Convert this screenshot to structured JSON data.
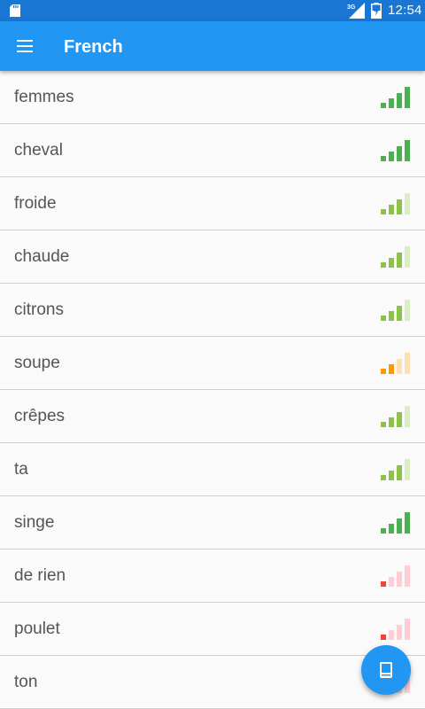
{
  "status_bar": {
    "network": "3G",
    "time": "12:54",
    "icons": [
      "sd-card-icon",
      "signal-icon",
      "battery-charging-icon"
    ]
  },
  "app_bar": {
    "title": "French",
    "menu_icon": "hamburger-menu-icon"
  },
  "colors": {
    "status_bar": "#1976d2",
    "app_bar": "#2196f3",
    "strong": "#4caf50",
    "medium": "#8bc34a",
    "weak": "#ff9800",
    "poor": "#f44336"
  },
  "words": [
    {
      "text": "femmes",
      "level": 4,
      "color": "#4caf50",
      "faded": "#c8e6c9"
    },
    {
      "text": "cheval",
      "level": 4,
      "color": "#4caf50",
      "faded": "#c8e6c9"
    },
    {
      "text": "froide",
      "level": 3,
      "color": "#8bc34a",
      "faded": "#dcedc8"
    },
    {
      "text": "chaude",
      "level": 3,
      "color": "#8bc34a",
      "faded": "#dcedc8"
    },
    {
      "text": "citrons",
      "level": 3,
      "color": "#8bc34a",
      "faded": "#dcedc8"
    },
    {
      "text": "soupe",
      "level": 2,
      "color": "#ff9800",
      "faded": "#ffe0b2"
    },
    {
      "text": "crêpes",
      "level": 3,
      "color": "#8bc34a",
      "faded": "#dcedc8"
    },
    {
      "text": "ta",
      "level": 3,
      "color": "#8bc34a",
      "faded": "#dcedc8"
    },
    {
      "text": "singe",
      "level": 4,
      "color": "#4caf50",
      "faded": "#c8e6c9"
    },
    {
      "text": "de rien",
      "level": 1,
      "color": "#f44336",
      "faded": "#ffcdd2"
    },
    {
      "text": "poulet",
      "level": 1,
      "color": "#f44336",
      "faded": "#ffcdd2"
    },
    {
      "text": "ton",
      "level": 1,
      "color": "#f44336",
      "faded": "#ffcdd2"
    }
  ],
  "fab": {
    "icon": "book-icon"
  }
}
